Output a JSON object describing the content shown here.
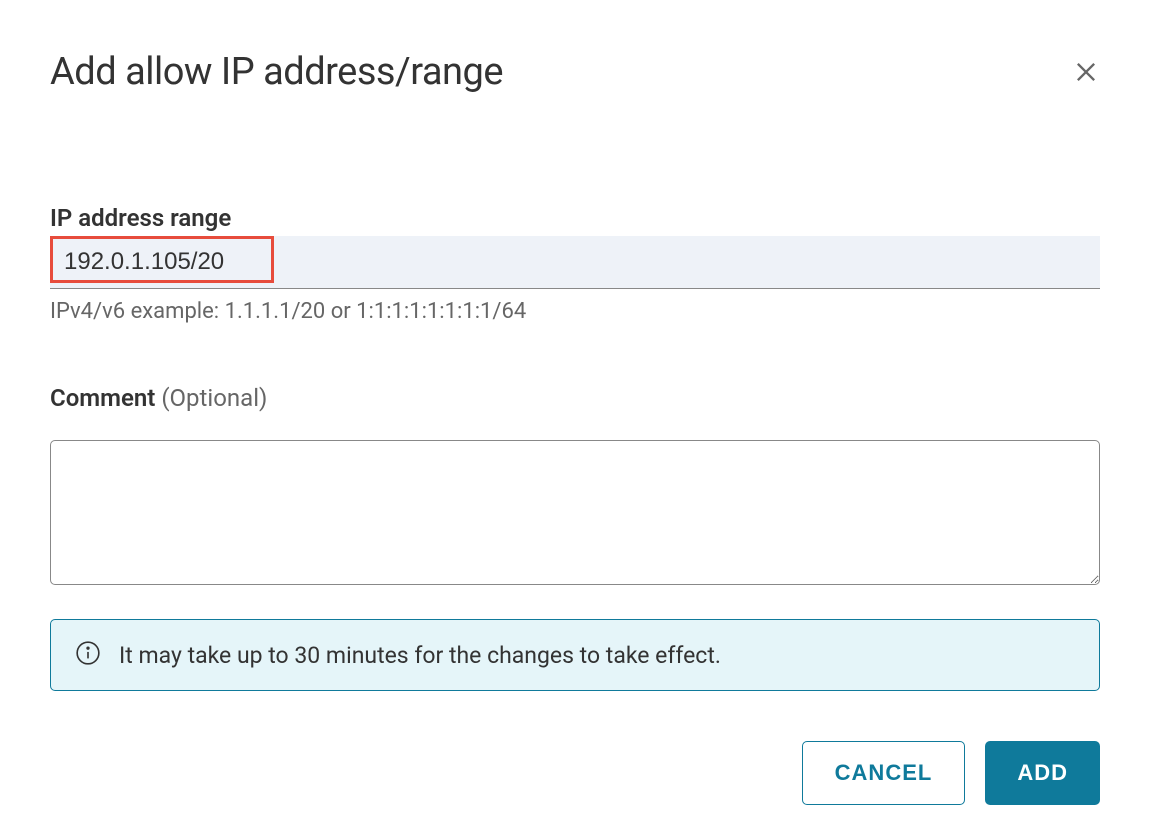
{
  "dialog": {
    "title": "Add allow IP address/range",
    "ip_range": {
      "label": "IP address range",
      "value": "192.0.1.105/20",
      "help_text": "IPv4/v6 example: 1.1.1.1/20 or 1:1:1:1:1:1:1:1/64"
    },
    "comment": {
      "label": "Comment",
      "optional_text": "(Optional)",
      "value": ""
    },
    "info_banner": {
      "text": "It may take up to 30 minutes for the changes to take effect."
    },
    "buttons": {
      "cancel": "CANCEL",
      "add": "ADD"
    }
  }
}
